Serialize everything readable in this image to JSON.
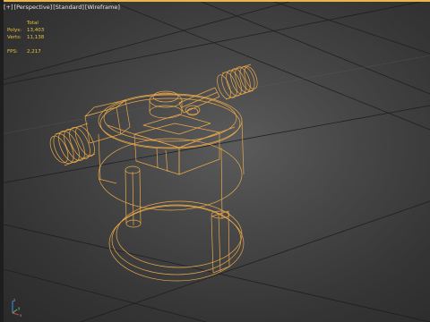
{
  "viewport": {
    "labels": [
      "[+]",
      "[Perspective]",
      "[Standard]",
      "[Wireframe]"
    ],
    "active_border_color": "#e8b64c",
    "wire_color": "#e9a84a"
  },
  "stats": {
    "total_label": "Total",
    "polys_label": "Polys:",
    "polys_value": "13,403",
    "verts_label": "Verts:",
    "verts_value": "11,138",
    "fps_label": "FPS:",
    "fps_value": "2,217"
  },
  "gizmo": {
    "axes": [
      "x",
      "y",
      "z"
    ]
  }
}
